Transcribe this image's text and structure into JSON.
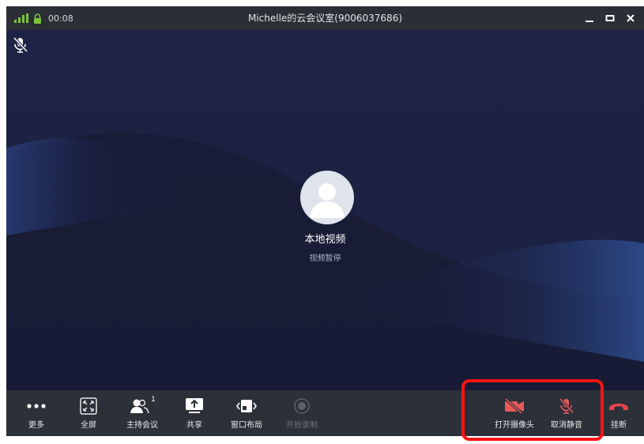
{
  "titlebar": {
    "time": "00:08",
    "title": "Michelle的云会议室(9006037686)",
    "minimize": "_",
    "maximize": "□",
    "close": "×"
  },
  "stage": {
    "participant_name": "本地视频",
    "participant_status": "视频暂停"
  },
  "toolbar": {
    "more": "更多",
    "fullscreen": "全屏",
    "host": "主持会议",
    "host_count": "1",
    "share": "共享",
    "layout": "窗口布局",
    "record": "开始录制",
    "camera": "打开摄像头",
    "unmute": "取消静音",
    "hangup": "挂断"
  },
  "colors": {
    "accent_red": "#e85a5a",
    "highlight": "#ff1212",
    "signal_green": "#7cc33c"
  }
}
